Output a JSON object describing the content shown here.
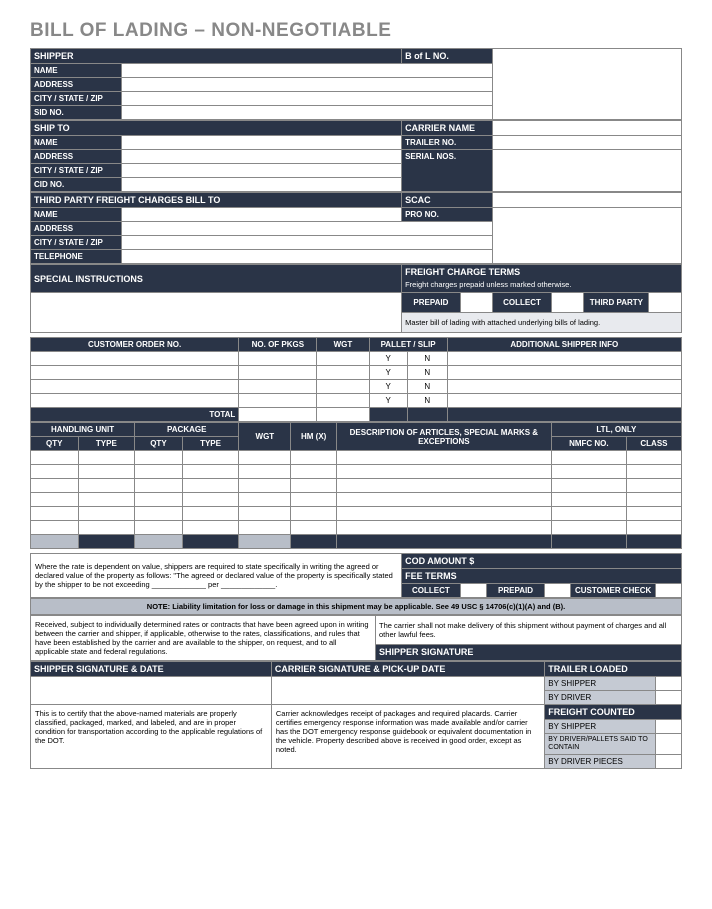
{
  "title": "BILL OF LADING – NON-NEGOTIABLE",
  "shipper": {
    "header": "SHIPPER",
    "name": "NAME",
    "address": "ADDRESS",
    "csz": "CITY / STATE / ZIP",
    "sid": "SID NO."
  },
  "bol_no": "B of L NO.",
  "shipto": {
    "header": "SHIP TO",
    "name": "NAME",
    "address": "ADDRESS",
    "csz": "CITY / STATE / ZIP",
    "cid": "CID NO."
  },
  "carrier": {
    "name": "CARRIER NAME",
    "trailer": "TRAILER NO.",
    "serial": "SERIAL NOS."
  },
  "third_party": {
    "header": "THIRD PARTY FREIGHT CHARGES BILL TO",
    "name": "NAME",
    "address": "ADDRESS",
    "csz": "CITY / STATE / ZIP",
    "telephone": "TELEPHONE"
  },
  "scac": "SCAC",
  "prono": "PRO NO.",
  "special_instr": "SPECIAL INSTRUCTIONS",
  "freight_terms": {
    "header": "FREIGHT CHARGE TERMS",
    "sub": "Freight charges prepaid unless marked otherwise.",
    "prepaid": "PREPAID",
    "collect": "COLLECT",
    "thirdparty": "THIRD PARTY",
    "master": "Master bill of lading with attached underlying bills of lading."
  },
  "order_table": {
    "customer_order": "CUSTOMER ORDER NO.",
    "no_pkgs": "NO. OF PKGS",
    "wgt": "WGT",
    "pallet_slip": "PALLET / SLIP",
    "addl_shipper": "ADDITIONAL SHIPPER INFO",
    "y": "Y",
    "n": "N",
    "total": "TOTAL"
  },
  "detail_table": {
    "handling_unit": "HANDLING UNIT",
    "package": "PACKAGE",
    "ltl_only": "LTL, ONLY",
    "qty": "QTY",
    "type": "TYPE",
    "wgt": "WGT",
    "hmx": "HM (X)",
    "description": "DESCRIPTION OF ARTICLES, SPECIAL MARKS & EXCEPTIONS",
    "nmfc": "NMFC NO.",
    "class": "CLASS"
  },
  "rate_note": "Where the rate is dependent on value, shippers are required to state specifically in writing the agreed or declared value of the property as follows: \"The agreed or declared value of the property is specifically stated by the shipper to be not exceeding _____________ per _____________.",
  "cod": "COD AMOUNT $",
  "fee_terms": "FEE TERMS",
  "fee_collect": "COLLECT",
  "fee_prepaid": "PREPAID",
  "fee_customer_check": "CUSTOMER CHECK",
  "liability_note": "NOTE: Liability limitation for loss or damage in this shipment may be applicable. See 49 USC § 14706(c)(1)(A) and (B).",
  "received_text": "Received, subject to individually determined rates or contracts that have been agreed upon in writing between the carrier and shipper, if applicable, otherwise to the rates, classifications, and rules that have been established by the carrier and are available to the shipper, on request, and to all applicable state and federal regulations.",
  "carrier_no_delivery": "The carrier shall not make delivery of this shipment without payment of charges and all other lawful fees.",
  "shipper_signature_hdr": "SHIPPER SIGNATURE",
  "shipper_sig_date": "SHIPPER SIGNATURE & DATE",
  "carrier_sig_date": "CARRIER SIGNATURE & PICK-UP DATE",
  "trailer_loaded": "TRAILER LOADED",
  "freight_counted": "FREIGHT COUNTED",
  "by_shipper": "BY SHIPPER",
  "by_driver": "BY DRIVER",
  "by_driver_pallets": "BY DRIVER/PALLETS SAID TO CONTAIN",
  "by_driver_pieces": "BY DRIVER PIECES",
  "certify_text": "This is to certify that the above-named materials are properly classified, packaged, marked, and labeled, and are in proper condition for transportation according to the applicable regulations of the DOT.",
  "carrier_ack_text": "Carrier acknowledges receipt of packages and required placards. Carrier certifies emergency response information was made available and/or carrier has the DOT emergency response guidebook or equivalent documentation in the vehicle. Property described above is received in good order, except as noted."
}
